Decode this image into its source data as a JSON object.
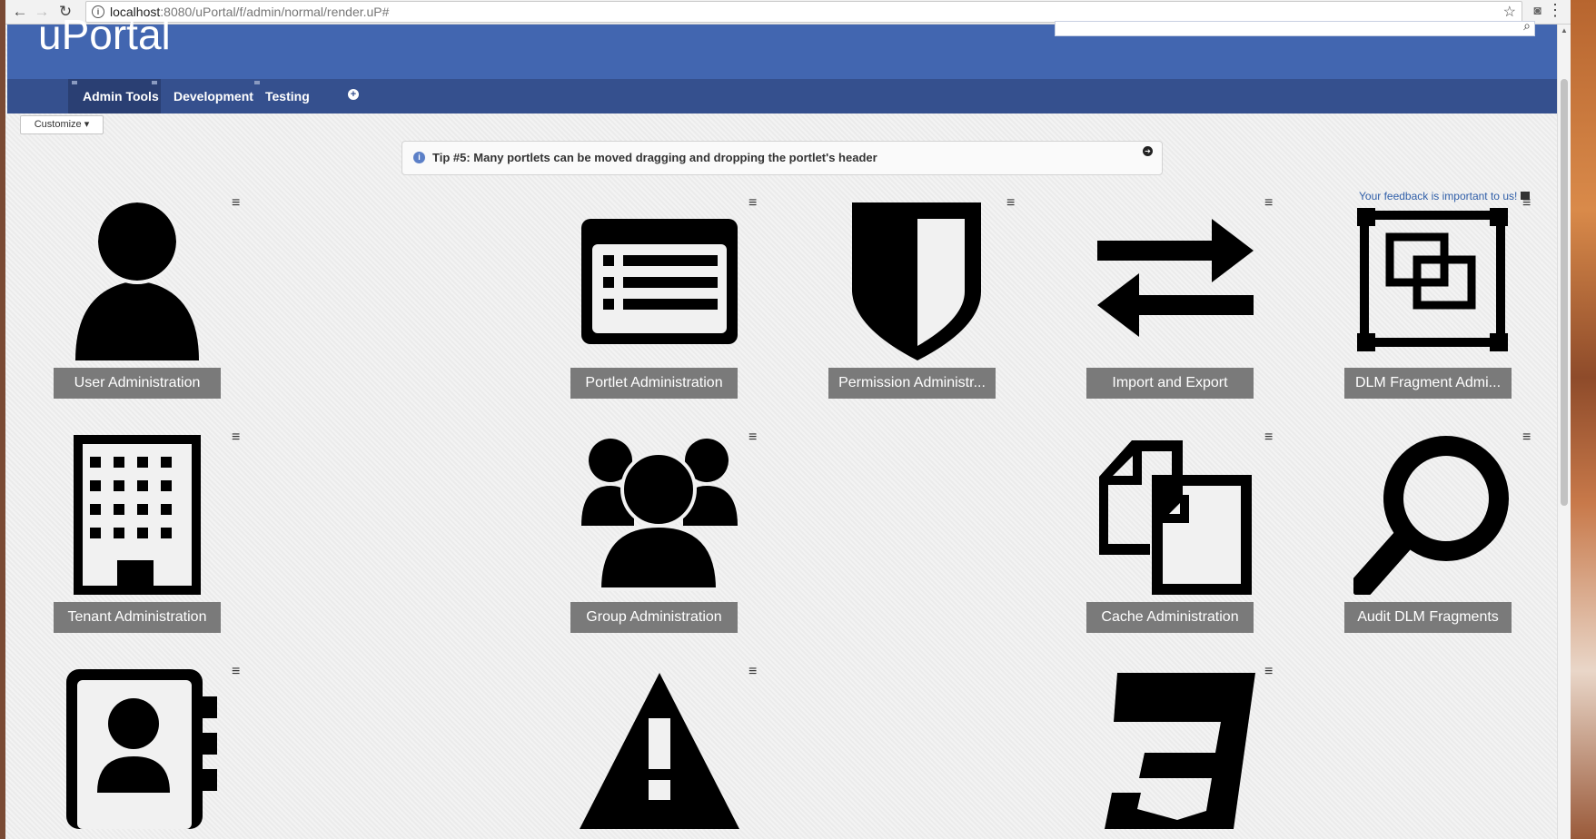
{
  "browser": {
    "url_host": "localhost",
    "url_rest": ":8080/uPortal/f/admin/normal/render.uP#"
  },
  "header": {
    "logo": "uPortal"
  },
  "tabs": [
    {
      "label": "Admin Tools",
      "active": true
    },
    {
      "label": "Development",
      "active": false
    },
    {
      "label": "Testing",
      "active": false
    }
  ],
  "customize_label": "Customize",
  "tip": {
    "text": "Tip #5: Many portlets can be moved dragging and dropping the portlet's header"
  },
  "feedback": "Your feedback is important to us!",
  "portlets": [
    {
      "label": "User Administration",
      "icon": "user-icon"
    },
    {
      "label": "Portlet Administration",
      "icon": "portlet-list-icon"
    },
    {
      "label": "Permission Administr...",
      "icon": "shield-icon"
    },
    {
      "label": "Import and Export",
      "icon": "exchange-arrows-icon"
    },
    {
      "label": "DLM Fragment Admi...",
      "icon": "fragment-icon"
    },
    {
      "label": "Tenant Administration",
      "icon": "building-icon"
    },
    {
      "label": "Group Administration",
      "icon": "group-icon"
    },
    {
      "label": "Cache Administration",
      "icon": "copy-documents-icon"
    },
    {
      "label": "Audit DLM Fragments",
      "icon": "magnifier-icon"
    },
    {
      "label": "",
      "icon": "address-book-icon"
    },
    {
      "label": "",
      "icon": "warning-icon"
    },
    {
      "label": "",
      "icon": "css3-icon"
    }
  ]
}
